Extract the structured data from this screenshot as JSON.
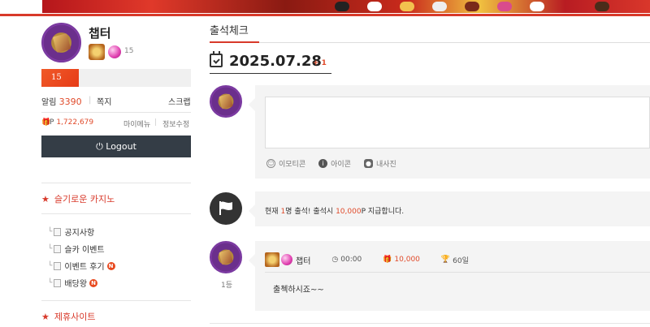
{
  "sidebar": {
    "username": "챕터",
    "level_num": "15",
    "progress_label": "15",
    "progress_fraction": 0.25,
    "alarm_label": "알림",
    "alarm_count": "3390",
    "memo_label": "쪽지",
    "scrap_label": "스크랩",
    "points_prefix": "P",
    "points_value": "1,722,679",
    "mymenu_label": "마이메뉴",
    "edit_label": "정보수정",
    "logout_label": "Logout",
    "section1_title": "슬기로운 카지노",
    "menu_items": [
      {
        "label": "공지사항",
        "new": ""
      },
      {
        "label": "슬카 이벤트",
        "new": ""
      },
      {
        "label": "이벤트 후기",
        "new": "N"
      },
      {
        "label": "배당왕",
        "new": "N"
      }
    ],
    "section2_title": "제휴사이트"
  },
  "main": {
    "tab_title": "출석체크",
    "date": "2025.07.28",
    "date_plus": "+ 1",
    "composer": {
      "emoticon_label": "이모티콘",
      "icon_label": "아이콘",
      "photo_label": "내사진"
    },
    "notice": {
      "prefix": "현재",
      "count": "1",
      "middle": "명 출석! 출석시",
      "points": "10,000",
      "suffix": "P 지급합니다."
    },
    "comment": {
      "name": "챕터",
      "time": "00:00",
      "points": "10,000",
      "days": "60일",
      "body": "출첵하시죠~~",
      "rank": "1등"
    }
  },
  "colors": {
    "accent": "#d8392a",
    "logout_bg": "#343d46",
    "card_bg": "#f4f4f4"
  }
}
